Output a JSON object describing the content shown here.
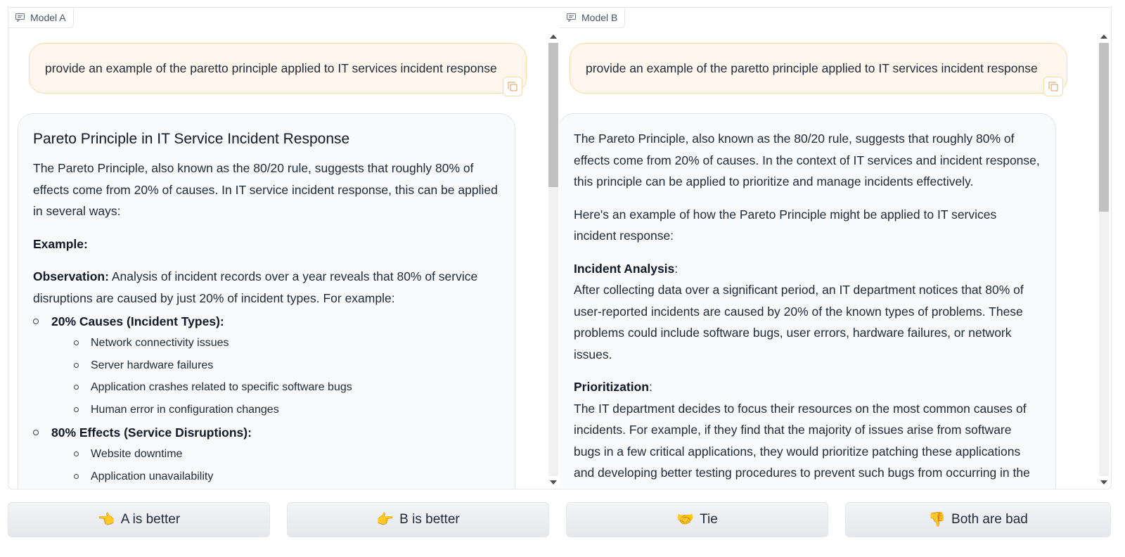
{
  "panel_a": {
    "tag": "Model A",
    "user_message": "provide an example of the paretto principle applied to IT services incident response",
    "heading": "Pareto Principle in IT Service Incident Response",
    "intro": "The Pareto Principle, also known as the 80/20 rule, suggests that roughly 80% of effects come from 20% of causes. In IT service incident response, this can be applied in several ways:",
    "example_label": "Example:",
    "observation_label": "Observation:",
    "observation_text": " Analysis of incident records over a year reveals that 80% of service disruptions are caused by just 20% of incident types. For example:",
    "causes_label": "20% Causes (Incident Types):",
    "causes": [
      "Network connectivity issues",
      "Server hardware failures",
      "Application crashes related to specific software bugs",
      "Human error in configuration changes"
    ],
    "effects_label": "80% Effects (Service Disruptions):",
    "effects": [
      "Website downtime",
      "Application unavailability"
    ]
  },
  "panel_b": {
    "tag": "Model B",
    "user_message": "provide an example of the paretto principle applied to IT services incident response",
    "p1": "The Pareto Principle, also known as the 80/20 rule, suggests that roughly 80% of effects come from 20% of causes. In the context of IT services and incident response, this principle can be applied to prioritize and manage incidents effectively.",
    "p2": "Here's an example of how the Pareto Principle might be applied to IT services incident response:",
    "analysis_label": "Incident Analysis",
    "analysis_text": "After collecting data over a significant period, an IT department notices that 80% of user-reported incidents are caused by 20% of the known types of problems. These problems could include software bugs, user errors, hardware failures, or network issues.",
    "prioritization_label": "Prioritization",
    "prioritization_text": "The IT department decides to focus their resources on the most common causes of incidents. For example, if they find that the majority of issues arise from software bugs in a few critical applications, they would prioritize patching these applications and developing better testing procedures to prevent such bugs from occurring in the future."
  },
  "buttons": {
    "a_better": {
      "emoji": "👈",
      "label": "A is better"
    },
    "b_better": {
      "emoji": "👉",
      "label": "B is better"
    },
    "tie": {
      "emoji": "🤝",
      "label": "Tie"
    },
    "both_bad": {
      "emoji": "👎",
      "label": "Both are bad"
    }
  },
  "colors": {
    "user_bubble_bg": "#fff7ed",
    "user_bubble_border": "#fcd9a8",
    "bot_bubble_bg": "#f9fafb"
  }
}
